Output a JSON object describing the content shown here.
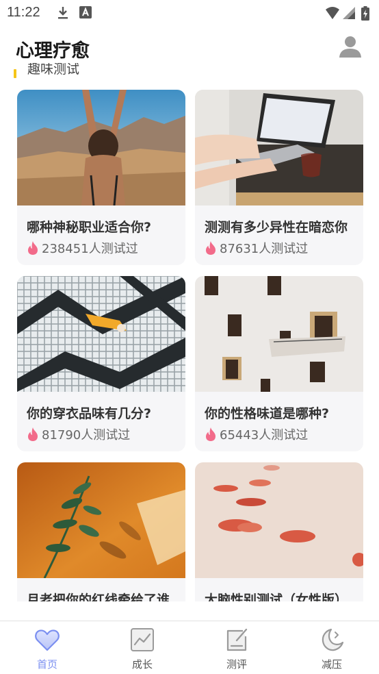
{
  "status_bar": {
    "time": "11:22"
  },
  "header": {
    "title": "心理疗愈"
  },
  "section": {
    "title": "趣味测试",
    "accent_color": "#f5c518"
  },
  "cards": [
    {
      "title": "哪种神秘职业适合你?",
      "count": "238451人测试过",
      "image": "desert-woman-raising-arms"
    },
    {
      "title": "测测有多少异性在暗恋你",
      "count": "87631人测试过",
      "image": "hands-typing-laptop"
    },
    {
      "title": "你的穿衣品味有几分?",
      "count": "81790人测试过",
      "image": "person-lying-on-tiled-maze"
    },
    {
      "title": "你的性格味道是哪种?",
      "count": "65443人测试过",
      "image": "white-building-windows"
    },
    {
      "title": "月老把你的红线牵给了谁",
      "count": "",
      "image": "plant-shadow-orange-wall"
    },
    {
      "title": "大脑性别测试（女性版）",
      "count": "",
      "image": "scattered-red-hearts"
    }
  ],
  "tabs": [
    {
      "label": "首页",
      "icon": "heart-icon",
      "active": true
    },
    {
      "label": "成长",
      "icon": "chart-icon",
      "active": false
    },
    {
      "label": "测评",
      "icon": "edit-icon",
      "active": false
    },
    {
      "label": "减压",
      "icon": "moon-icon",
      "active": false
    }
  ],
  "colors": {
    "accent": "#7b8ff0",
    "fire": "#f26b8a"
  }
}
